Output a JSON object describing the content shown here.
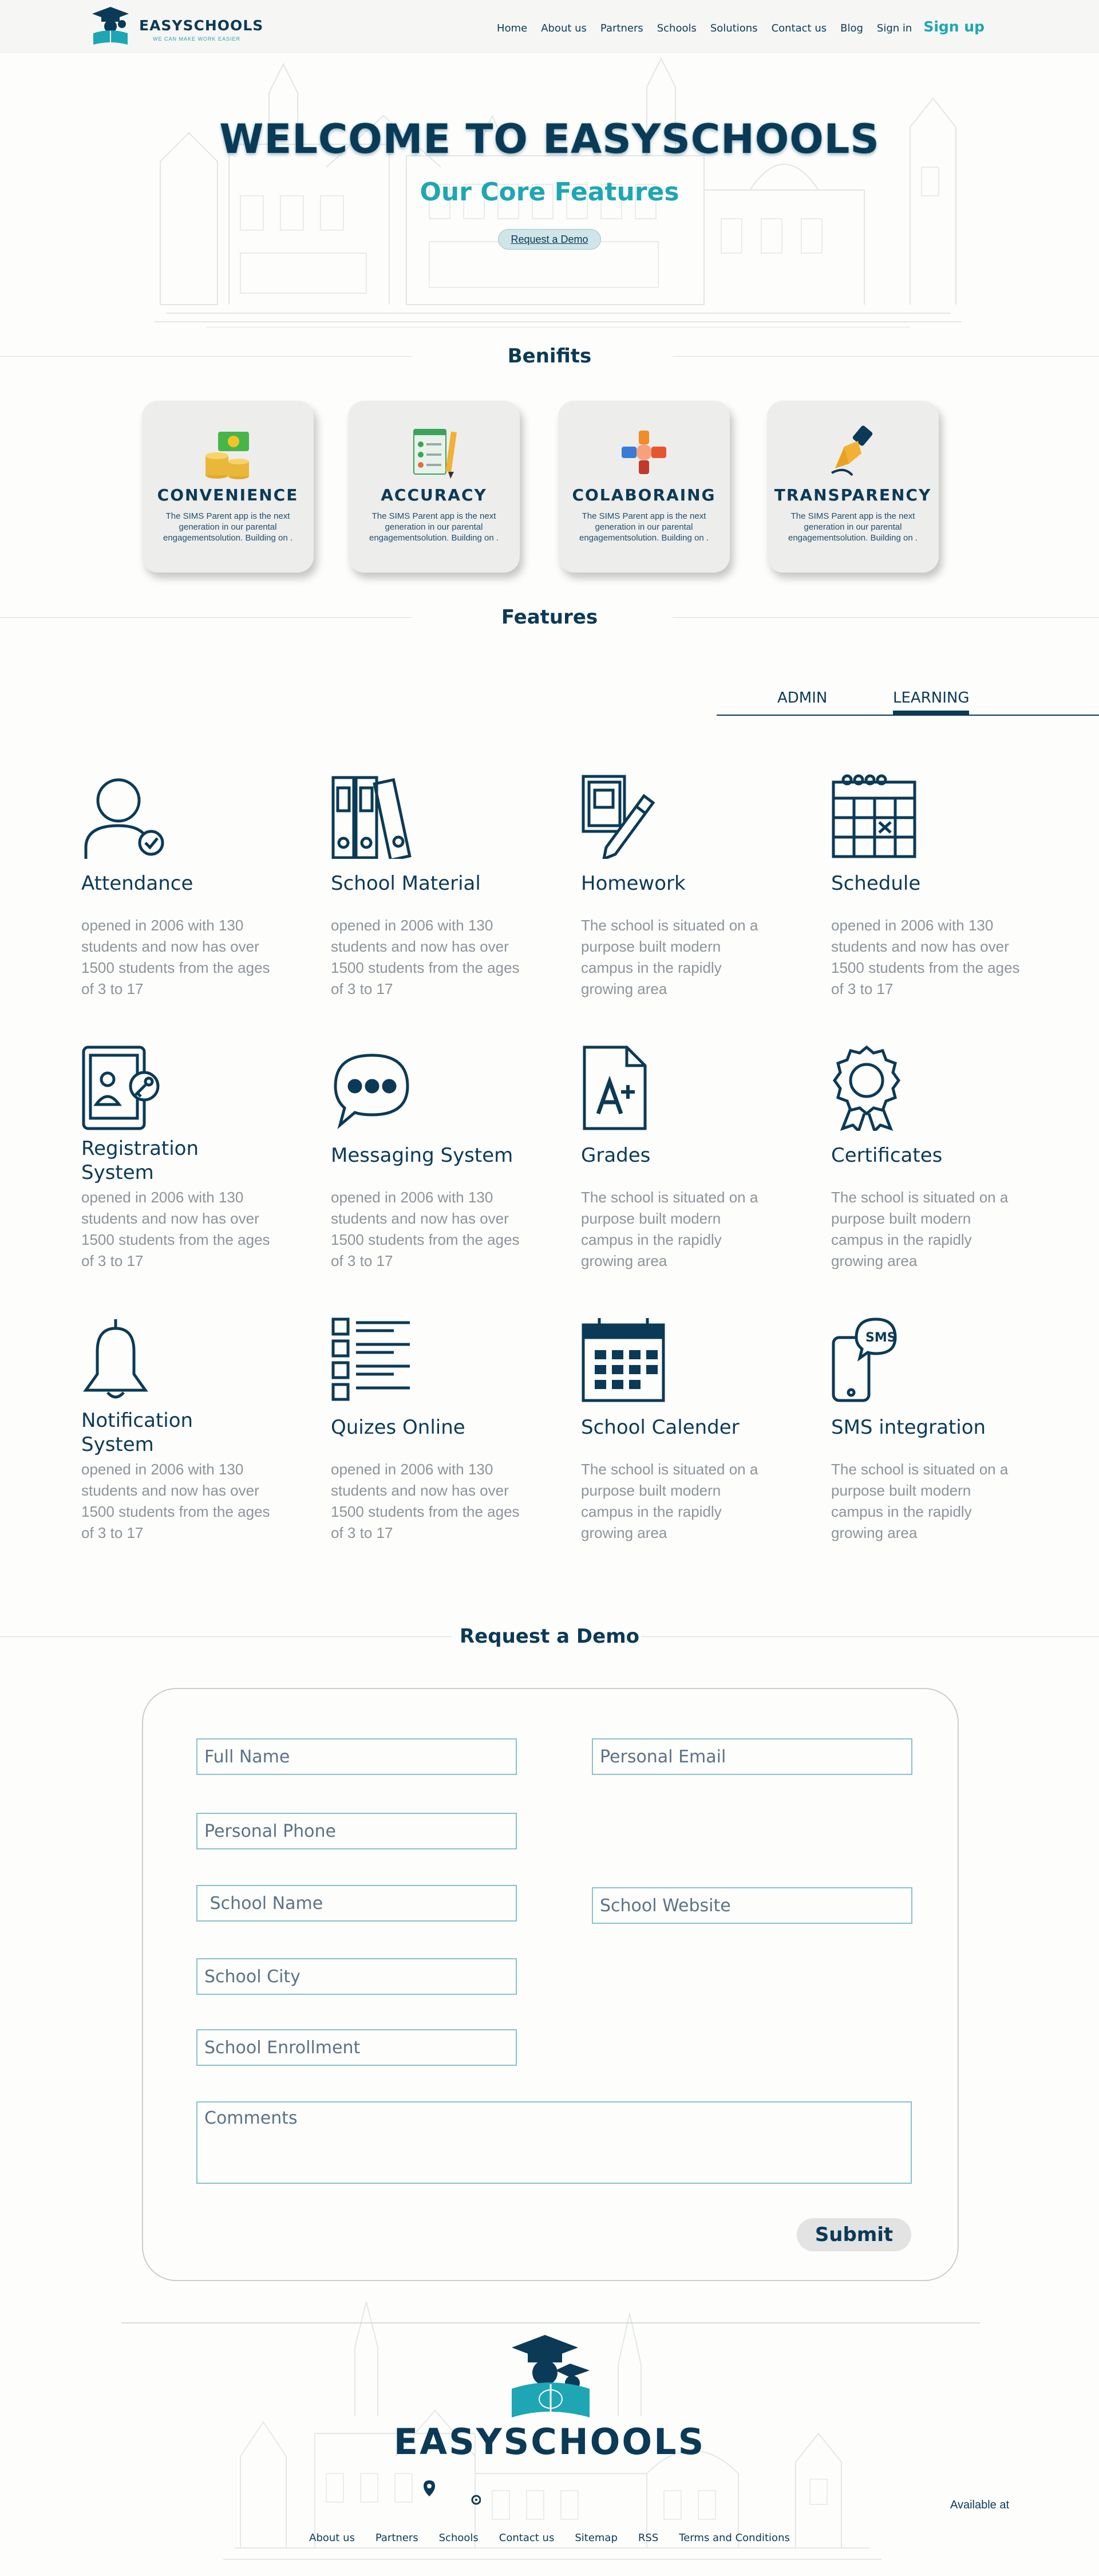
{
  "brand": {
    "name": "EASYSCHOOLS",
    "tagline": "WE CAN MAKE WORK EASIER"
  },
  "nav": {
    "links": [
      "Home",
      "About us",
      "Partners",
      "Schools",
      "Solutions",
      "Contact us",
      "Blog",
      "Sign in"
    ],
    "signup": "Sign up"
  },
  "hero": {
    "title": "WELCOME TO EASYSCHOOLS",
    "subtitle": "Our Core Features",
    "cta": "Request a Demo"
  },
  "benefits": {
    "heading": "Benifits",
    "items": [
      {
        "title": "CONVENIENCE",
        "text": "The SIMS Parent app is the next generation in our parental engagementsolution. Building on ."
      },
      {
        "title": "ACCURACY",
        "text": "The SIMS Parent app is the next generation in our parental engagementsolution. Building on ."
      },
      {
        "title": "COLABORAING",
        "text": "The SIMS Parent app is the next generation in our parental engagementsolution. Building on ."
      },
      {
        "title": "TRANSPARENCY",
        "text": "The SIMS Parent app is the next generation in our parental engagementsolution. Building on ."
      }
    ]
  },
  "features": {
    "heading": "Features",
    "tabs": {
      "admin": "ADMIN",
      "learning": "LEARNING"
    },
    "active_tab": "LEARNING",
    "items": [
      {
        "title": "Attendance",
        "desc": "opened in 2006 with 130 students and now has over 1500 students from the ages of 3 to 17"
      },
      {
        "title": "School Material",
        "desc": "opened in 2006 with 130 students and now has over 1500 students from the ages of 3 to 17"
      },
      {
        "title": "Homework",
        "desc": "The school is situated on a purpose built modern campus in the rapidly growing area"
      },
      {
        "title": "Schedule",
        "desc": "opened in 2006 with 130 students and now has over 1500 students from the ages of 3 to 17"
      },
      {
        "title": "Registration System",
        "desc": "opened in 2006 with 130 students and now has over 1500 students from the ages of 3 to 17"
      },
      {
        "title": "Messaging System",
        "desc": "opened in 2006 with 130 students and now has over 1500 students from the ages of 3 to 17"
      },
      {
        "title": "Grades",
        "desc": "The school is situated on a purpose built modern campus in the rapidly growing area"
      },
      {
        "title": "Certificates",
        "desc": "The school is situated on a purpose built modern campus in the rapidly growing area"
      },
      {
        "title": "Notification System",
        "desc": "opened in 2006 with 130 students and now has over 1500 students from the ages of 3 to 17"
      },
      {
        "title": "Quizes Online",
        "desc": "opened in 2006 with 130 students and now has over 1500 students from the ages of 3 to 17"
      },
      {
        "title": "School Calender",
        "desc": "The school is situated on a purpose built modern campus in the rapidly growing area"
      },
      {
        "title": "SMS integration",
        "desc": "The school is situated on a purpose built modern campus in the rapidly growing area"
      }
    ]
  },
  "demo": {
    "heading": "Request a Demo",
    "fields": {
      "full_name": "Full Name",
      "personal_email": "Personal Email",
      "personal_phone": "Personal Phone",
      "school_name": " School Name",
      "school_website": "School Website",
      "school_city": "School City",
      "school_enrollment": "School Enrollment",
      "comments": "Comments"
    },
    "submit": "Submit"
  },
  "footer": {
    "name": "EASYSCHOOLS",
    "available": "Available at",
    "links": [
      "About us",
      "Partners",
      "Schools",
      "Contact us",
      "Sitemap",
      "RSS",
      "Terms and Conditions"
    ]
  },
  "colors": {
    "primary": "#0b3a57",
    "accent": "#1ea6b5",
    "muted_text": "#8c949b",
    "field_border": "#86c3cc"
  }
}
